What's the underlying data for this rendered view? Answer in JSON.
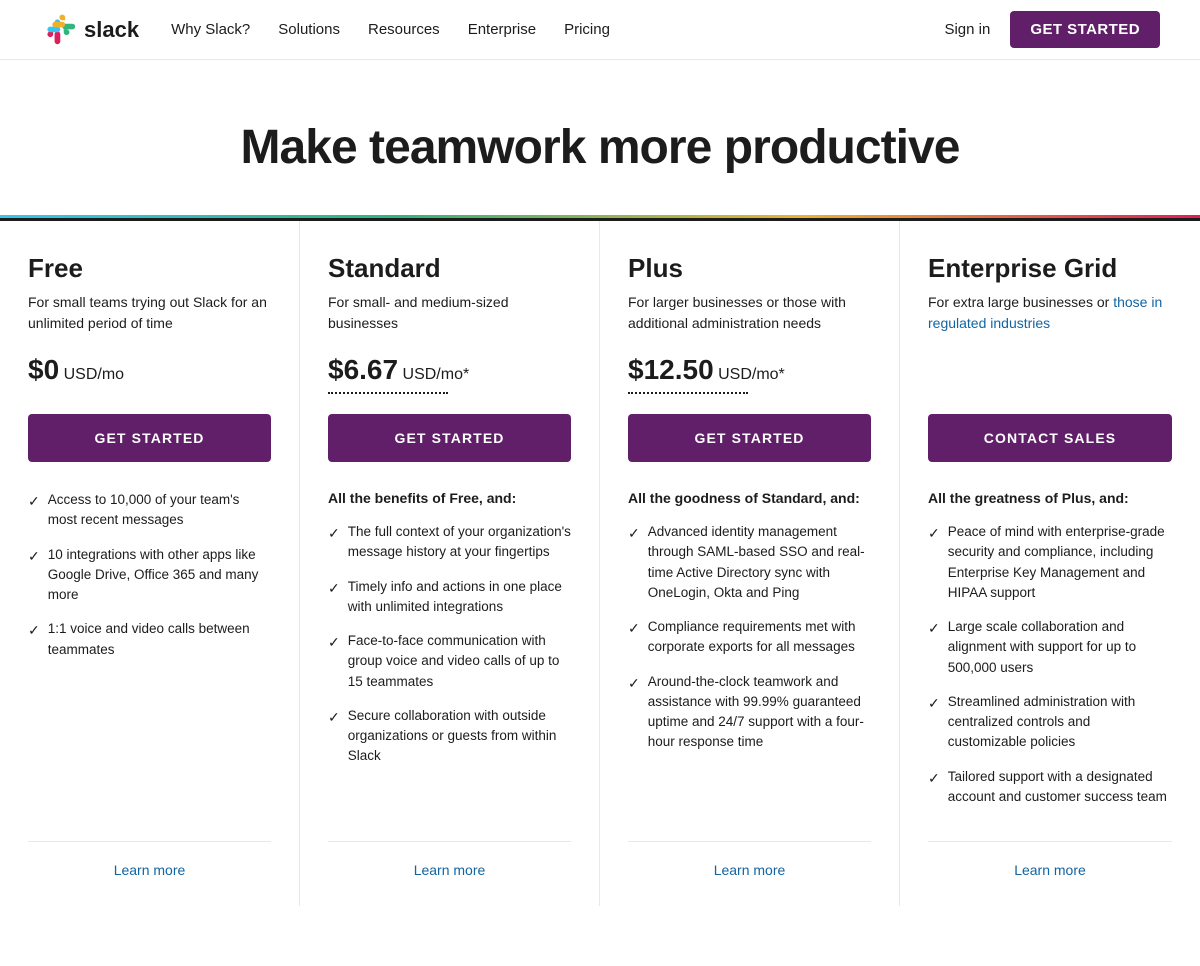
{
  "nav": {
    "logo_text": "slack",
    "links": [
      {
        "label": "Why Slack?",
        "href": "#"
      },
      {
        "label": "Solutions",
        "href": "#"
      },
      {
        "label": "Resources",
        "href": "#"
      },
      {
        "label": "Enterprise",
        "href": "#"
      },
      {
        "label": "Pricing",
        "href": "#"
      }
    ],
    "signin_label": "Sign in",
    "cta_label": "GET STARTED"
  },
  "hero": {
    "title": "Make teamwork more productive"
  },
  "plans": [
    {
      "name": "Free",
      "desc": "For small teams trying out Slack for an unlimited period of time",
      "desc_link": null,
      "price_prefix": "$0",
      "price_suffix": " USD/mo",
      "price_star": false,
      "btn_label": "GET STARTED",
      "benefits_title": null,
      "features": [
        "Access to 10,000 of your team's most recent messages",
        "10 integrations with other apps like Google Drive, Office 365 and many more",
        "1:1 voice and video calls between teammates"
      ],
      "learn_more": "Learn more"
    },
    {
      "name": "Standard",
      "desc": "For small- and medium-sized businesses",
      "desc_link": null,
      "price_prefix": "$6.67",
      "price_suffix": " USD/mo*",
      "price_star": true,
      "btn_label": "GET STARTED",
      "benefits_title": "All the benefits of Free, and:",
      "features": [
        "The full context of your organization's message history at your fingertips",
        "Timely info and actions in one place with unlimited integrations",
        "Face-to-face communication with group voice and video calls of up to 15 teammates",
        "Secure collaboration with outside organizations or guests from within Slack"
      ],
      "learn_more": "Learn more"
    },
    {
      "name": "Plus",
      "desc": "For larger businesses or those with additional administration needs",
      "desc_link": null,
      "price_prefix": "$12.50",
      "price_suffix": " USD/mo*",
      "price_star": true,
      "btn_label": "GET STARTED",
      "benefits_title": "All the goodness of Standard, and:",
      "features": [
        "Advanced identity management through SAML-based SSO and real-time Active Directory sync with OneLogin, Okta and Ping",
        "Compliance requirements met with corporate exports for all messages",
        "Around-the-clock teamwork and assistance with 99.99% guaranteed uptime and 24/7 support with a four-hour response time"
      ],
      "learn_more": "Learn more"
    },
    {
      "name": "Enterprise Grid",
      "desc_part1": "For extra large businesses or ",
      "desc_link_text": "those in regulated industries",
      "desc_part2": "",
      "price_prefix": "",
      "price_suffix": "",
      "price_star": false,
      "btn_label": "CONTACT SALES",
      "benefits_title": "All the greatness of Plus, and:",
      "features": [
        "Peace of mind with enterprise-grade security and compliance, including Enterprise Key Management and HIPAA support",
        "Large scale collaboration and alignment with support for up to 500,000 users",
        "Streamlined administration with centralized controls and customizable policies",
        "Tailored support with a designated account and customer success team"
      ],
      "learn_more": "Learn more"
    }
  ]
}
